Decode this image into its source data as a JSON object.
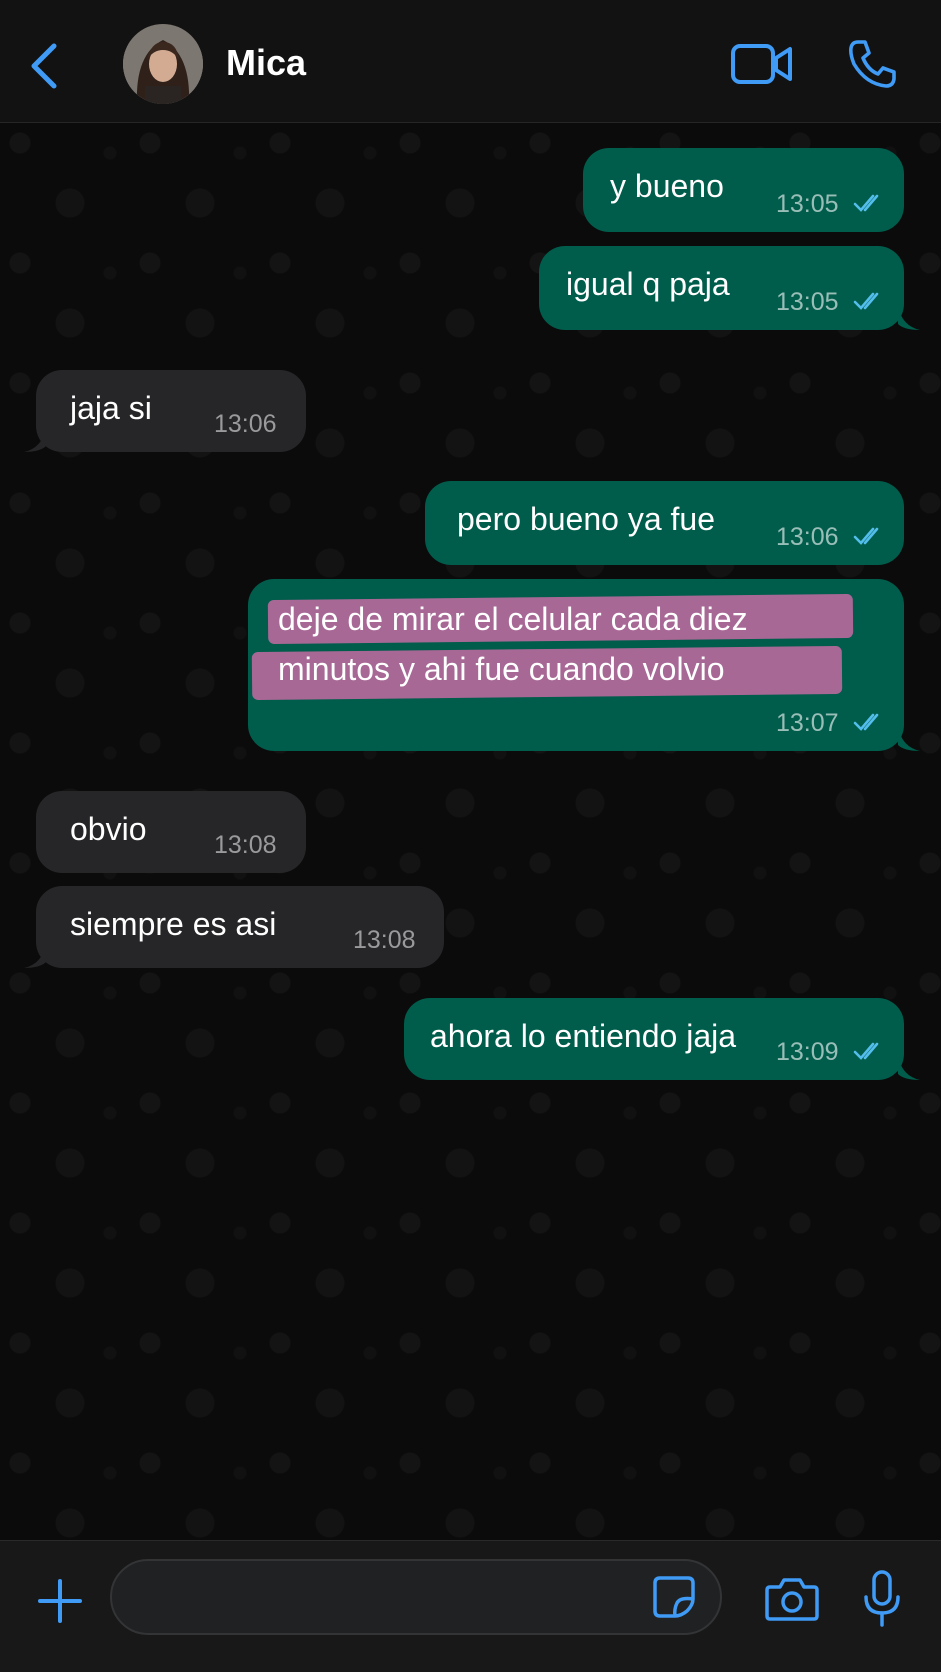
{
  "header": {
    "contact_name": "Mica",
    "back_icon": "chevron-left-icon",
    "video_icon": "video-camera-icon",
    "call_icon": "phone-icon"
  },
  "messages": [
    {
      "direction": "outgoing",
      "text": "y bueno",
      "time": "13:05",
      "status": "read"
    },
    {
      "direction": "outgoing",
      "text": "igual q paja",
      "time": "13:05",
      "status": "read"
    },
    {
      "direction": "incoming",
      "text": "jaja si",
      "time": "13:06"
    },
    {
      "direction": "outgoing",
      "text": "pero bueno ya fue",
      "time": "13:06",
      "status": "read"
    },
    {
      "direction": "outgoing",
      "text": "deje de mirar el celular cada diez minutos y ahi fue cuando volvio",
      "time": "13:07",
      "status": "read",
      "highlighted": true
    },
    {
      "direction": "incoming",
      "text": "obvio",
      "time": "13:08"
    },
    {
      "direction": "incoming",
      "text": "siempre es asi",
      "time": "13:08"
    },
    {
      "direction": "outgoing",
      "text": "ahora lo entiendo jaja",
      "time": "13:09",
      "status": "read"
    }
  ],
  "composer": {
    "value": "",
    "placeholder": "",
    "plus_icon": "plus-icon",
    "sticker_icon": "sticker-icon",
    "camera_icon": "camera-icon",
    "mic_icon": "microphone-icon"
  },
  "colors": {
    "accent": "#3f9bf5",
    "outgoing_bubble": "#005c4b",
    "incoming_bubble": "#262628",
    "highlight": "#d66caa",
    "read_ticks": "#53bdeb"
  }
}
